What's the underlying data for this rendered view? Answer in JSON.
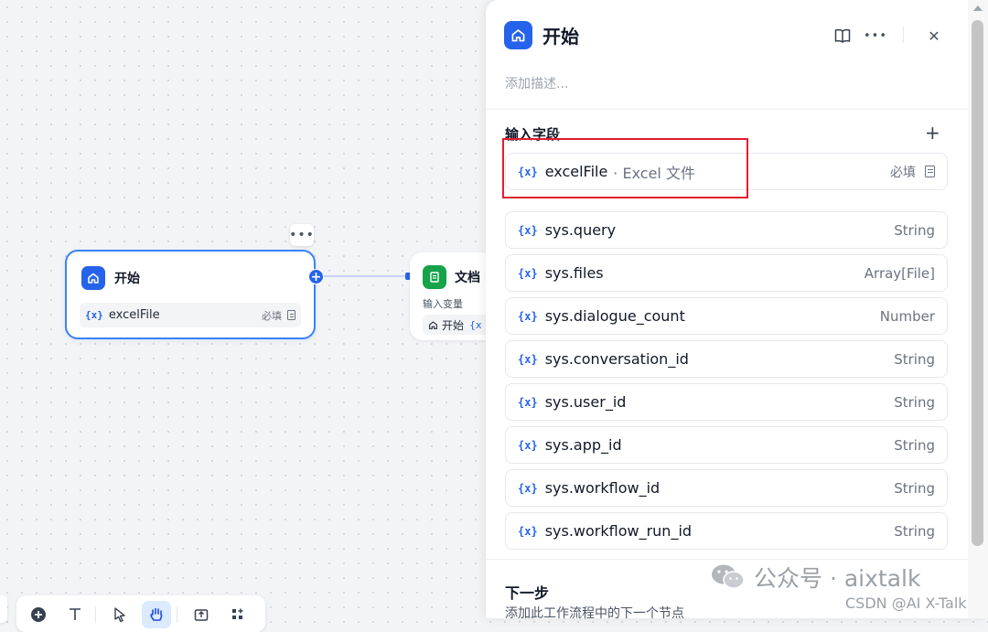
{
  "canvas": {
    "start_node": {
      "title": "开始",
      "more": "•••",
      "add": "+",
      "variable": {
        "mark": "{x}",
        "name": "excelFile",
        "required": "必填"
      }
    },
    "doc_node": {
      "title": "文档",
      "subtitle": "输入变量",
      "chip_label": "开始",
      "chip_mark": "{x"
    }
  },
  "panel": {
    "title": "开始",
    "description_placeholder": "添加描述...",
    "input_section_title": "输入字段",
    "add": "+",
    "close": "✕",
    "more": "•••",
    "fields": [
      {
        "mark": "{x}",
        "name": "excelFile",
        "sub": "· Excel 文件",
        "required": "必填"
      },
      {
        "mark": "{x}",
        "name": "sys.query",
        "type": "String"
      },
      {
        "mark": "{x}",
        "name": "sys.files",
        "type": "Array[File]"
      },
      {
        "mark": "{x}",
        "name": "sys.dialogue_count",
        "type": "Number"
      },
      {
        "mark": "{x}",
        "name": "sys.conversation_id",
        "type": "String"
      },
      {
        "mark": "{x}",
        "name": "sys.user_id",
        "type": "String"
      },
      {
        "mark": "{x}",
        "name": "sys.app_id",
        "type": "String"
      },
      {
        "mark": "{x}",
        "name": "sys.workflow_id",
        "type": "String"
      },
      {
        "mark": "{x}",
        "name": "sys.workflow_run_id",
        "type": "String"
      }
    ],
    "next_step": {
      "title": "下一步",
      "description": "添加此工作流程中的下一个节点"
    }
  },
  "watermark": {
    "wechat": "公众号 · aixtalk",
    "csdn": "CSDN @AI X-Talk"
  },
  "colors": {
    "accent": "#2563eb",
    "doc_node": "#16a34a",
    "highlight": "#e11d2e"
  },
  "icons": [
    "home-icon",
    "document-icon",
    "book-icon",
    "more-icon",
    "close-icon",
    "plus-icon",
    "hand-icon",
    "pointer-icon"
  ]
}
